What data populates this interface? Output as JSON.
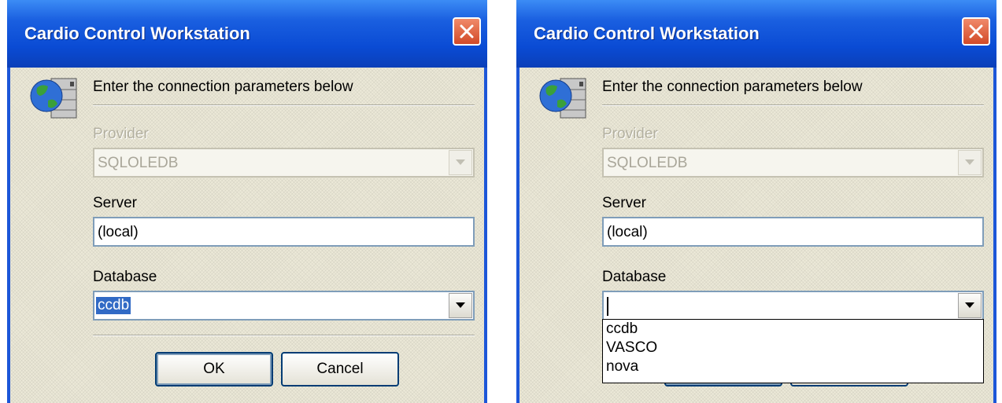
{
  "dialogs": [
    {
      "title": "Cardio Control Workstation",
      "header": "Enter the connection parameters below",
      "provider_label": "Provider",
      "provider_value": "SQLOLEDB",
      "server_label": "Server",
      "server_value": "(local)",
      "database_label": "Database",
      "database_value": "ccdb",
      "ok_label": "OK",
      "cancel_label": "Cancel"
    },
    {
      "title": "Cardio Control Workstation",
      "header": "Enter the connection parameters below",
      "provider_label": "Provider",
      "provider_value": "SQLOLEDB",
      "server_label": "Server",
      "server_value": "(local)",
      "database_label": "Database",
      "database_value": "",
      "database_options": [
        "ccdb",
        "VASCO",
        "nova"
      ]
    }
  ],
  "colors": {
    "titlebar": "#0a4bd4",
    "dialog_background": "#ece9d8",
    "selection": "#316ac5",
    "close_button": "#d24a28"
  },
  "icons": {
    "app": "database-globe-icon",
    "close": "close-icon",
    "dropdown": "chevron-down-icon"
  }
}
